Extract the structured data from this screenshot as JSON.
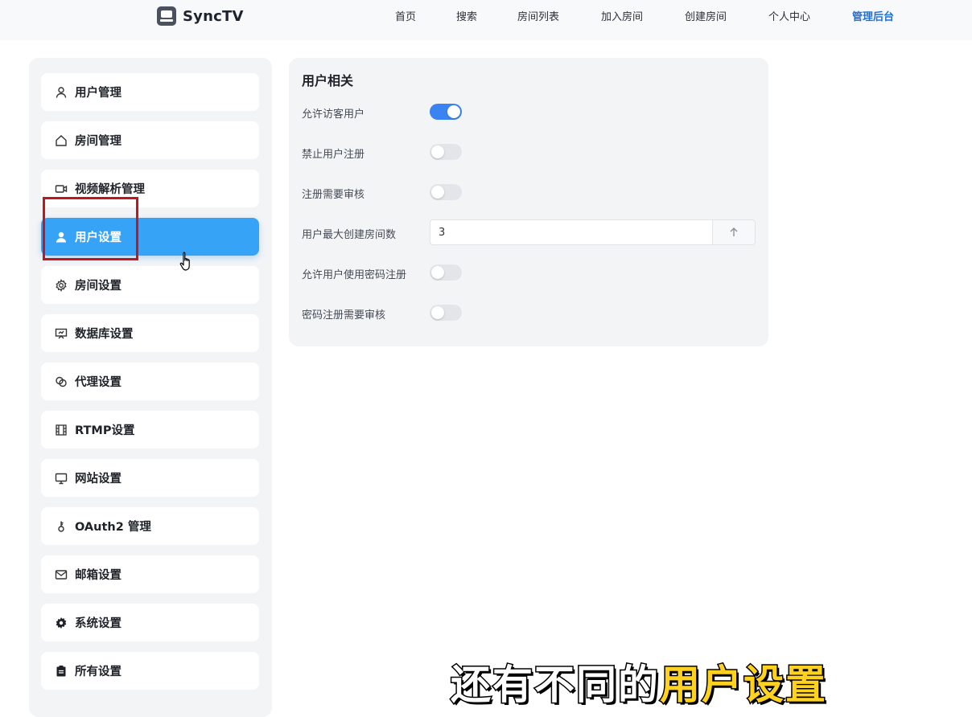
{
  "brand": {
    "name": "SyncTV",
    "icon": "tv-logo-icon"
  },
  "nav": {
    "items": [
      {
        "label": "首页",
        "active": false
      },
      {
        "label": "搜索",
        "active": false
      },
      {
        "label": "房间列表",
        "active": false
      },
      {
        "label": "加入房间",
        "active": false
      },
      {
        "label": "创建房间",
        "active": false
      },
      {
        "label": "个人中心",
        "active": false
      },
      {
        "label": "管理后台",
        "active": true
      }
    ],
    "active_color": "#1e6fd9"
  },
  "sidebar": {
    "items": [
      {
        "label": "用户管理",
        "icon": "user-icon"
      },
      {
        "label": "房间管理",
        "icon": "home-icon"
      },
      {
        "label": "视频解析管理",
        "icon": "video-icon"
      },
      {
        "label": "用户设置",
        "icon": "user-filled-icon",
        "active": true
      },
      {
        "label": "房间设置",
        "icon": "gear-icon"
      },
      {
        "label": "数据库设置",
        "icon": "presentation-icon"
      },
      {
        "label": "代理设置",
        "icon": "link-icon"
      },
      {
        "label": "RTMP设置",
        "icon": "film-icon"
      },
      {
        "label": "网站设置",
        "icon": "monitor-icon"
      },
      {
        "label": "OAuth2 管理",
        "icon": "key-icon"
      },
      {
        "label": "邮箱设置",
        "icon": "mail-icon"
      },
      {
        "label": "系统设置",
        "icon": "cog-filled-icon"
      },
      {
        "label": "所有设置",
        "icon": "clipboard-icon"
      }
    ],
    "active_color": "#36a3f7",
    "highlight_color": "#c0161c"
  },
  "panel": {
    "title": "用户相关",
    "rows": [
      {
        "label": "允许访客用户",
        "type": "toggle",
        "on": true
      },
      {
        "label": "禁止用户注册",
        "type": "toggle",
        "on": false
      },
      {
        "label": "注册需要审核",
        "type": "toggle",
        "on": false
      },
      {
        "label": "用户最大创建房间数",
        "type": "number",
        "value": "3"
      },
      {
        "label": "允许用户使用密码注册",
        "type": "toggle",
        "on": false
      },
      {
        "label": "密码注册需要审核",
        "type": "toggle",
        "on": false
      }
    ],
    "toggle_on_color": "#3a84f2"
  },
  "caption": {
    "part1": "还有不同的",
    "part2": "用户设置",
    "highlight_color": "#ffd21f"
  }
}
